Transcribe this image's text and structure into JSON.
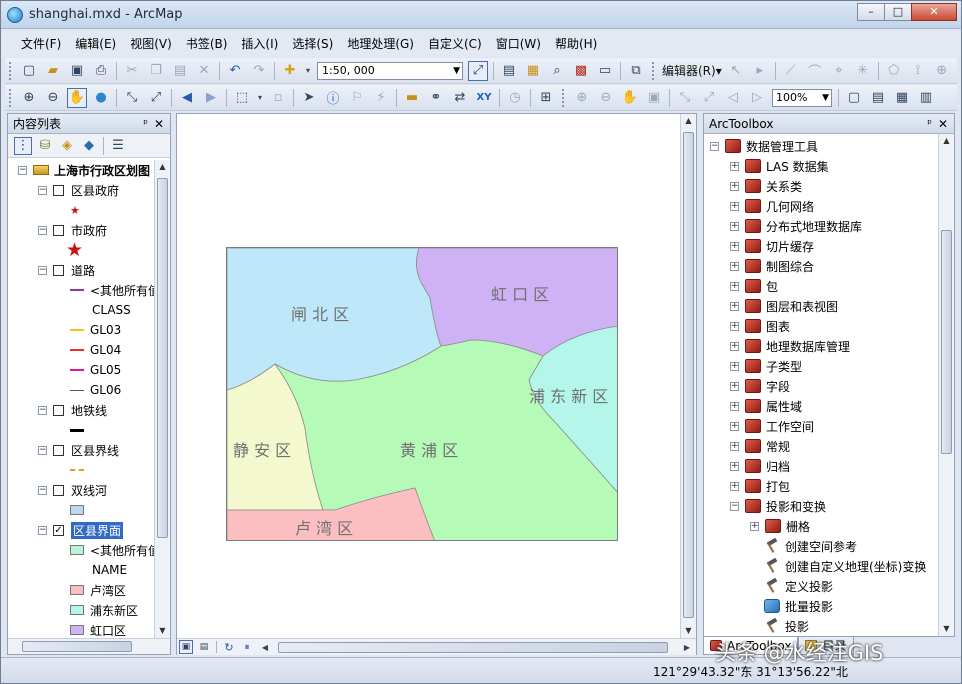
{
  "window": {
    "title": "shanghai.mxd - ArcMap",
    "min": "–",
    "max": "□",
    "close": "✕"
  },
  "menu": [
    "文件(F)",
    "编辑(E)",
    "视图(V)",
    "书签(B)",
    "插入(I)",
    "选择(S)",
    "地理处理(G)",
    "自定义(C)",
    "窗口(W)",
    "帮助(H)"
  ],
  "toolbar": {
    "scale": "1:50, 000",
    "editor_label": "编辑器(R)▾",
    "zoom_percent": "100%"
  },
  "toc": {
    "title": "内容列表",
    "pin": "ᵖ",
    "close": "✕",
    "root": "上海市行政区划图",
    "layers": [
      {
        "name": "区县政府",
        "checked": false
      },
      {
        "name": "市政府",
        "checked": false
      },
      {
        "name": "道路",
        "checked": false
      },
      {
        "name": "地铁线",
        "checked": false
      },
      {
        "name": "区县界线",
        "checked": false
      },
      {
        "name": "双线河",
        "checked": false
      },
      {
        "name": "区县界面",
        "checked": true
      }
    ],
    "road_legend": {
      "other": "<其他所有值",
      "field": "CLASS",
      "items": [
        "GL03",
        "GL04",
        "GL05",
        "GL06"
      ]
    },
    "district_legend": {
      "other": "<其他所有值",
      "field": "NAME",
      "items": [
        "卢湾区",
        "浦东新区",
        "虹口区"
      ]
    },
    "check_mark": "✓"
  },
  "map": {
    "districts": [
      {
        "label": "闸 北 区",
        "color": "#bee8fa"
      },
      {
        "label": "虹 口 区",
        "color": "#cfb1f5"
      },
      {
        "label": "浦 东 新 区",
        "color": "#b4f7ea"
      },
      {
        "label": "静 安 区",
        "color": "#f3f8ce"
      },
      {
        "label": "黄 浦 区",
        "color": "#b6fab8"
      },
      {
        "label": "卢 湾 区",
        "color": "#fbbfc1"
      }
    ]
  },
  "arctoolbox": {
    "title": "ArcToolbox",
    "root": "数据管理工具",
    "toolsets": [
      "LAS 数据集",
      "关系类",
      "几何网络",
      "分布式地理数据库",
      "切片缓存",
      "制图综合",
      "包",
      "图层和表视图",
      "图表",
      "地理数据库管理",
      "子类型",
      "字段",
      "属性域",
      "工作空间",
      "常规",
      "归档",
      "打包",
      "投影和变换"
    ],
    "sub_toolset": "栅格",
    "tools": [
      "创建空间参考",
      "创建自定义地理(坐标)变换",
      "定义投影",
      "批量投影",
      "投影"
    ],
    "tabs": [
      "ArcToolbox",
      "目录"
    ]
  },
  "status": {
    "coords": "121°29'43.32\"东  31°13'56.22\"北"
  },
  "watermark": "头条 @水经注GIS",
  "colors": {
    "selection": "#3169c6",
    "star": "#cc1111",
    "gl03": "#f2c418",
    "gl04": "#e8302a",
    "gl05": "#e0179b",
    "gl06": "#555555"
  }
}
